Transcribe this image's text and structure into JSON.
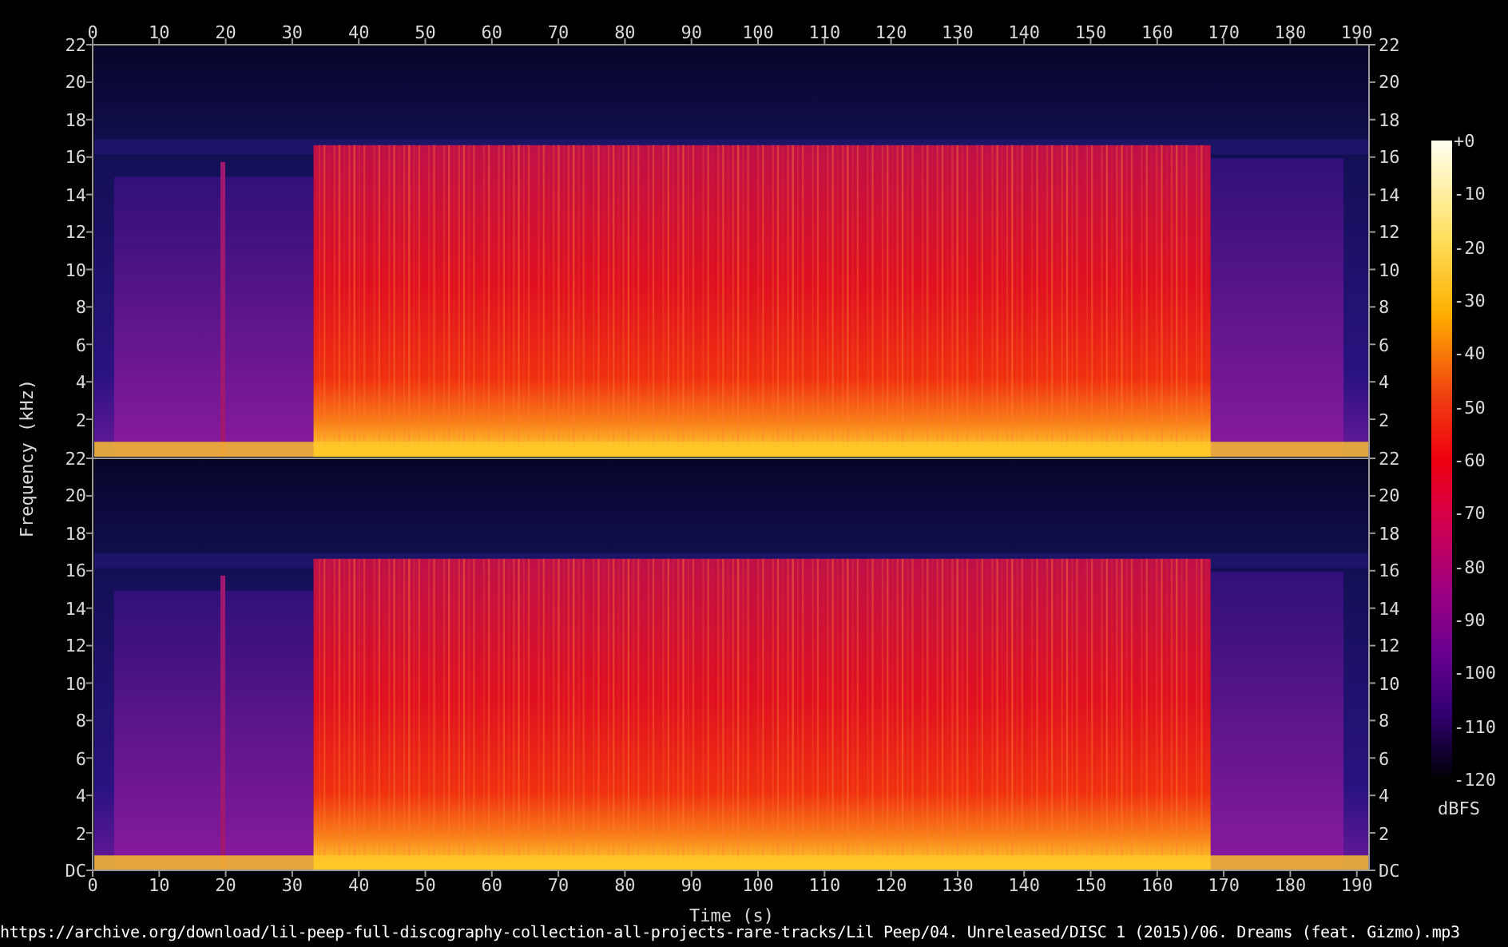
{
  "x_axis_top": {
    "ticks": [
      "0",
      "10",
      "20",
      "30",
      "40",
      "50",
      "60",
      "70",
      "80",
      "90",
      "100",
      "110",
      "120",
      "130",
      "140",
      "150",
      "160",
      "170",
      "180",
      "190"
    ]
  },
  "channels": [
    {
      "left_ticks": [
        "22",
        "20",
        "18",
        "16",
        "14",
        "12",
        "10",
        "8",
        "6",
        "4",
        "2"
      ],
      "right_ticks": [
        "22",
        "20",
        "18",
        "16",
        "14",
        "12",
        "10",
        "8",
        "6",
        "4",
        "2"
      ]
    },
    {
      "left_ticks": [
        "22",
        "20",
        "18",
        "16",
        "14",
        "12",
        "10",
        "8",
        "6",
        "4",
        "2",
        "DC"
      ],
      "right_ticks": [
        "22",
        "20",
        "18",
        "16",
        "14",
        "12",
        "10",
        "8",
        "6",
        "4",
        "2",
        "DC"
      ]
    }
  ],
  "x_axis_bottom": {
    "ticks": [
      "0",
      "10",
      "20",
      "30",
      "40",
      "50",
      "60",
      "70",
      "80",
      "90",
      "100",
      "110",
      "120",
      "130",
      "140",
      "150",
      "160",
      "170",
      "180",
      "190"
    ]
  },
  "ylabel": "Frequency (kHz)",
  "xlabel": "Time (s)",
  "colorbar": {
    "ticks": [
      "+0",
      "-10",
      "-20",
      "-30",
      "-40",
      "-50",
      "-60",
      "-70",
      "-80",
      "-90",
      "-100",
      "-110",
      "-120"
    ],
    "unit": "dBFS"
  },
  "source_path": "https://archive.org/download/lil-peep-full-discography-collection-all-projects-rare-tracks/Lil Peep/04. Unreleased/DISC 1 (2015)/06. Dreams (feat. Gizmo).mp3"
}
